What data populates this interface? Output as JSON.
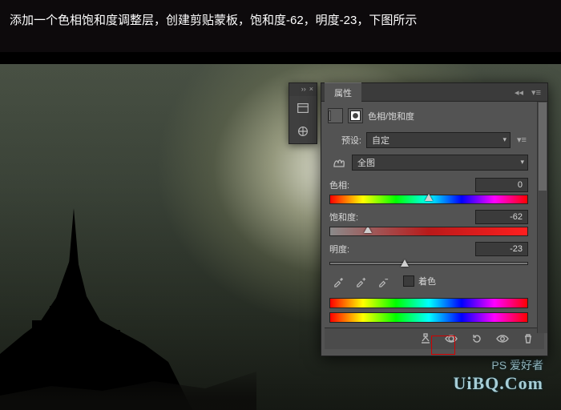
{
  "caption": "添加一个色相饱和度调整层，创建剪贴蒙板，饱和度-62，明度-23，下图所示",
  "watermark": {
    "brand": "PS 爱好者",
    "site": "UiBQ.Com"
  },
  "panel": {
    "tab": "属性",
    "title": "色相/饱和度",
    "preset": {
      "label": "预设:",
      "value": "自定"
    },
    "channel": {
      "value": "全图"
    },
    "hue": {
      "label": "色相:",
      "value": "0",
      "pos": 50
    },
    "saturation": {
      "label": "饱和度:",
      "value": "-62",
      "pos": 19
    },
    "lightness": {
      "label": "明度:",
      "value": "-23",
      "pos": 38
    },
    "colorize": {
      "label": "着色",
      "checked": false
    }
  },
  "chart_data": {
    "type": "table",
    "title": "色相/饱和度",
    "series": [
      {
        "name": "色相",
        "values": [
          0
        ]
      },
      {
        "name": "饱和度",
        "values": [
          -62
        ]
      },
      {
        "name": "明度",
        "values": [
          -23
        ]
      }
    ],
    "range": [
      -100,
      100
    ]
  }
}
